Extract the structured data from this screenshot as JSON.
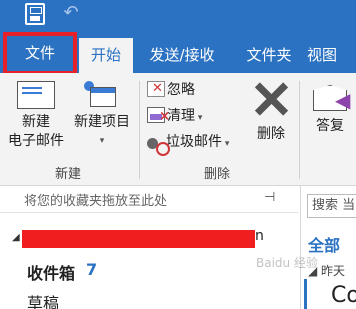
{
  "quick_access": {
    "save_icon": "save-icon",
    "undo_icon": "undo-icon"
  },
  "tabs": {
    "file": "文件",
    "home": "开始",
    "send_receive": "发送/接收",
    "folder": "文件夹",
    "view": "视图"
  },
  "ribbon": {
    "new_group": {
      "new_email": "新建\n电子邮件",
      "new_email_line1": "新建",
      "new_email_line2": "电子邮件",
      "new_items_line1": "新建项目",
      "new_items_caret": "▾",
      "label": "新建"
    },
    "delete_group": {
      "ignore": "忽略",
      "clean_up": "清理",
      "junk": "垃圾邮件",
      "delete": "删除",
      "label": "删除"
    },
    "respond_group": {
      "reply": "答复"
    }
  },
  "folder_pane": {
    "favorites_hint": "将您的收藏夹拖放至此处",
    "account_tail": "n",
    "inbox_label": "收件箱",
    "inbox_count": "7",
    "drafts_label": "草稿"
  },
  "message_list": {
    "search_placeholder": "搜索 当",
    "filter_all": "全部",
    "group_yesterday": "昨天",
    "item_preview": "Co"
  },
  "watermark": "Baidu 经验",
  "colors": {
    "accent": "#2b72c2",
    "highlight_box": "#e8202a",
    "redaction": "#f01e1e"
  }
}
